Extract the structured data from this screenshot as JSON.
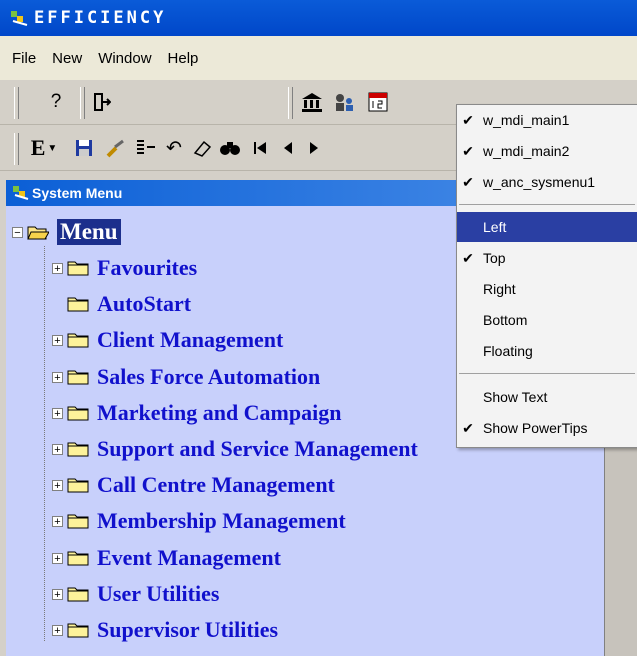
{
  "app": {
    "title": "EFFICIENCY"
  },
  "menubar": {
    "items": [
      "File",
      "New",
      "Window",
      "Help"
    ]
  },
  "toolbar1": {
    "icons": [
      "help-icon",
      "exit-icon",
      "bank-icon",
      "users-icon",
      "calendar-icon"
    ]
  },
  "toolbar2": {
    "icons": [
      "font-icon",
      "save-icon",
      "brush-icon",
      "list-icon",
      "undo-icon",
      "eraser-icon",
      "find-icon",
      "first-icon",
      "prev-icon",
      "next-icon"
    ]
  },
  "panel": {
    "title": "System Menu"
  },
  "tree": {
    "root": "Menu",
    "items": [
      {
        "label": "Favourites",
        "expandable": true
      },
      {
        "label": "AutoStart",
        "expandable": false
      },
      {
        "label": "Client Management",
        "expandable": true
      },
      {
        "label": "Sales Force Automation",
        "expandable": true
      },
      {
        "label": "Marketing and Campaign",
        "expandable": true
      },
      {
        "label": "Support and Service Management",
        "expandable": true
      },
      {
        "label": "Call Centre Management",
        "expandable": true
      },
      {
        "label": "Membership Management",
        "expandable": true
      },
      {
        "label": "Event Management",
        "expandable": true
      },
      {
        "label": "User Utilities",
        "expandable": true
      },
      {
        "label": "Supervisor Utilities",
        "expandable": true
      }
    ]
  },
  "popup": {
    "windows": [
      {
        "label": "w_mdi_main1",
        "checked": true
      },
      {
        "label": "w_mdi_main2",
        "checked": true
      },
      {
        "label": "w_anc_sysmenu1",
        "checked": true
      }
    ],
    "positions": [
      {
        "label": "Left",
        "checked": false,
        "selected": true
      },
      {
        "label": "Top",
        "checked": true
      },
      {
        "label": "Right",
        "checked": false
      },
      {
        "label": "Bottom",
        "checked": false
      },
      {
        "label": "Floating",
        "checked": false
      }
    ],
    "options": [
      {
        "label": "Show Text",
        "checked": false
      },
      {
        "label": "Show PowerTips",
        "checked": true
      }
    ]
  },
  "colors": {
    "titlebar": "#0047c9",
    "tree_bg": "#c8d0fb",
    "tree_text": "#1111cc",
    "selection": "#2a3fa3"
  }
}
